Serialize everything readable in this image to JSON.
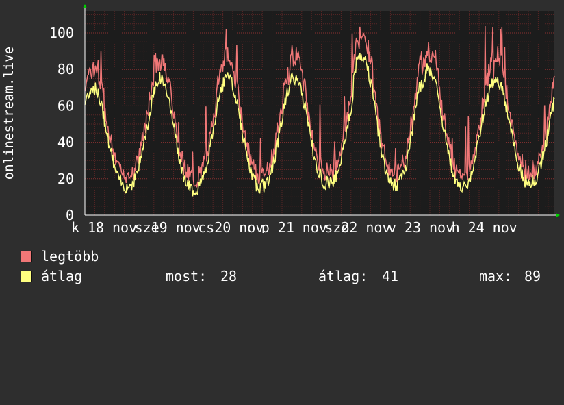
{
  "chart_data": {
    "type": "line",
    "ylabel": "onlinestream.live",
    "ylim": [
      0,
      110
    ],
    "yticks": [
      0,
      20,
      40,
      60,
      80,
      100
    ],
    "grid": true,
    "x_tick_labels": [
      "k",
      "18",
      "nov",
      "sze",
      "19",
      "nov",
      "cs",
      "20",
      "nov",
      "p",
      "21",
      "nov",
      "szo",
      "22",
      "nov",
      "v",
      "23",
      "nov",
      "h",
      "24",
      "nov"
    ],
    "peaks": [
      {
        "max": 75,
        "avg": 70
      },
      {
        "max": 85,
        "avg": 75
      },
      {
        "max": 102,
        "avg": 75
      },
      {
        "max": 80,
        "avg": 75
      },
      {
        "max": 91,
        "avg": 88
      },
      {
        "max": 90,
        "avg": 80
      },
      {
        "max": 80,
        "avg": 75
      }
    ],
    "troughs": [
      {
        "max": 28,
        "avg": 16
      },
      {
        "max": 28,
        "avg": 14
      },
      {
        "max": 25,
        "avg": 16
      },
      {
        "max": 27,
        "avg": 18
      },
      {
        "max": 32,
        "avg": 17
      },
      {
        "max": 28,
        "avg": 16
      },
      {
        "max": 29,
        "avg": 18
      }
    ],
    "series": [
      {
        "name": "legtöbb",
        "color": "#f07777"
      },
      {
        "name": "átlag",
        "color": "#ffff80"
      }
    ]
  },
  "legend": {
    "max_label": "legtöbb",
    "avg_label": "átlag",
    "now_label": "most:",
    "now_value": "28",
    "mean_label": "átlag:",
    "mean_value": "41",
    "max_stat_label": "max:",
    "max_value": "89"
  },
  "colors": {
    "background": "#2e2e2e",
    "plot": "#1c1c1c",
    "grid": "#7a2f2f",
    "axis": "#ffffff",
    "arrow": "#00d000"
  }
}
